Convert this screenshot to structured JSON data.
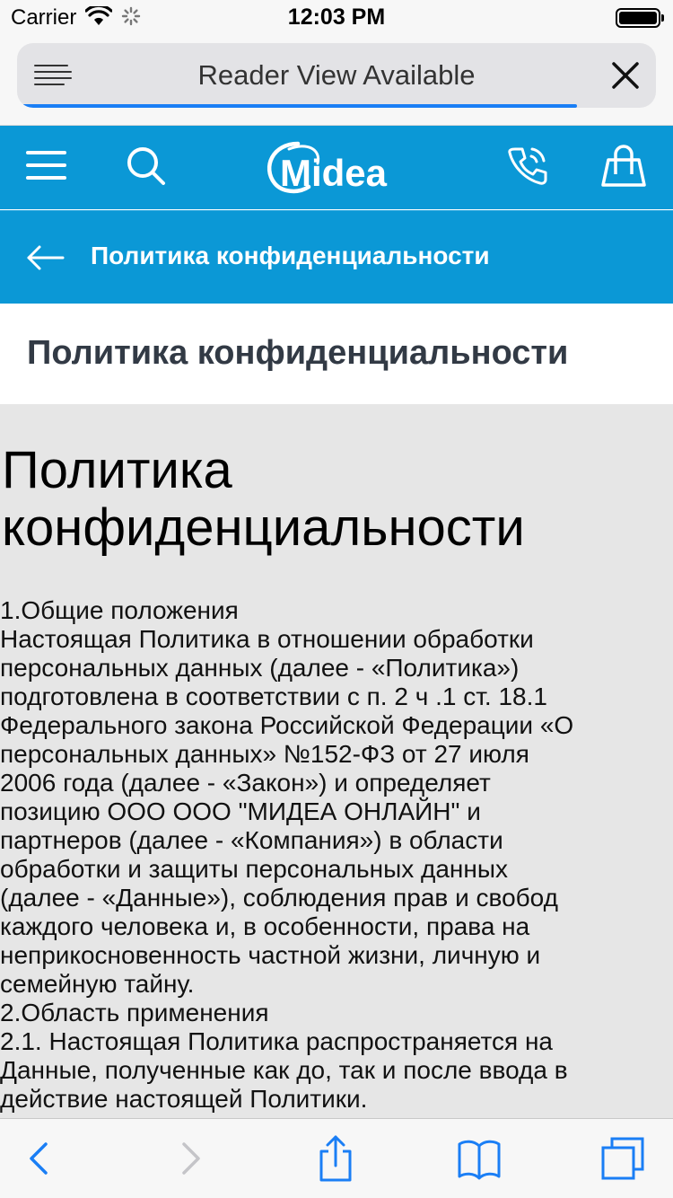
{
  "status_bar": {
    "carrier": "Carrier",
    "time": "12:03 PM"
  },
  "browser": {
    "address_text": "Reader View Available",
    "icons": {
      "reader": "reader-lines-icon",
      "close": "close-icon"
    },
    "load_progress": 0.88,
    "accent_color": "#1a7ef5"
  },
  "site": {
    "brand_color": "#0b98d6",
    "logo_text": "Midea",
    "header_icons": [
      "menu-icon",
      "search-icon",
      "phone-icon",
      "shopping-bag-icon"
    ],
    "sub_header_title": "Политика конфиденциальности",
    "page_title": "Политика конфиденциальности"
  },
  "document": {
    "heading_line1": "Политика",
    "heading_line2": "конфиденциальности",
    "lines": [
      "1.Общие положения",
      "Настоящая Политика в отношении обработки",
      "персональных данных (далее - «Политика»)",
      "подготовлена в соответствии с п. 2 ч .1 ст. 18.1",
      "Федерального закона Российской Федерации «О",
      "персональных данных» №152-ФЗ от 27 июля",
      "2006 года (далее - «Закон») и определяет",
      "позицию ООО ООО \"МИДЕА ОНЛАЙН\" и",
      "партнеров (далее - «Компания») в области",
      "обработки и защиты персональных данных",
      "(далее - «Данные»), соблюдения прав и свобод",
      "каждого человека и, в особенности, права на",
      "неприкосновенность частной жизни, личную и",
      "семейную тайну.",
      "2.Область применения",
      "2.1. Настоящая Политика распространяется на",
      "Данные, полученные как до, так и после ввода в",
      "действие настоящей Политики."
    ]
  },
  "toolbar": {
    "icons": [
      "back-icon",
      "forward-icon",
      "share-icon",
      "bookmarks-icon",
      "tabs-icon"
    ],
    "accent_color": "#1a7ef5"
  }
}
